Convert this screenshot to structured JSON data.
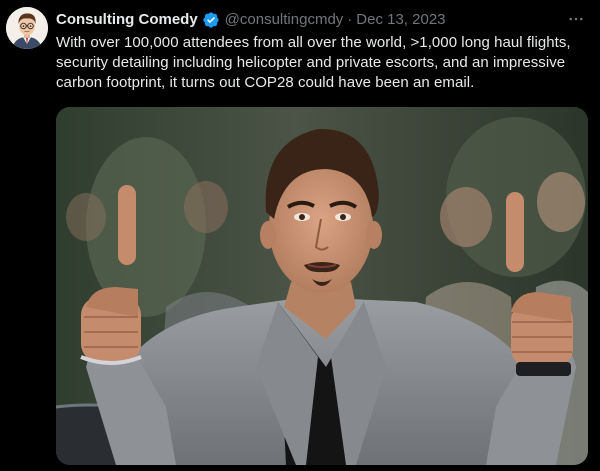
{
  "tweet": {
    "display_name": "Consulting Comedy",
    "handle": "@consultingcmdy",
    "separator": "·",
    "date": "Dec 13, 2023",
    "text": "With over 100,000 attendees from all over the world, >1,000 long haul flights, security detailing including helicopter and private escorts, and an impressive carbon footprint, it turns out COP28 could have been an email.",
    "more_icon": "more-horizontal-icon",
    "verified_icon": "verified-badge-icon"
  },
  "media": {
    "kind": "photo",
    "subject": "man in grey suit giving two thumbs up"
  },
  "colors": {
    "background": "#000000",
    "text_primary": "#e7e9ea",
    "text_secondary": "#71767b",
    "verified_blue": "#1d9bf0"
  }
}
